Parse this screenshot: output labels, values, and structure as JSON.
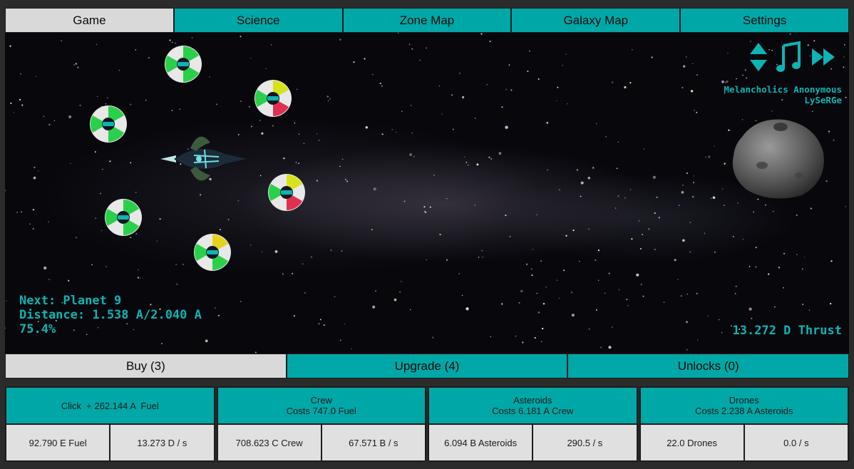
{
  "tabs": [
    {
      "label": "Game",
      "active": true
    },
    {
      "label": "Science",
      "active": false
    },
    {
      "label": "Zone Map",
      "active": false
    },
    {
      "label": "Galaxy Map",
      "active": false
    },
    {
      "label": "Settings",
      "active": false
    }
  ],
  "hud": {
    "next": "Next: Planet 9",
    "distance": "Distance: 1.538 A/2.040 A",
    "progress": "75.4%",
    "thrust": "13.272 D Thrust",
    "music_title": "Melancholics Anonymous",
    "music_artist": "LySeRGe"
  },
  "controls": {
    "icons": [
      "up-down-icon",
      "music-note-icon",
      "fast-forward-icon"
    ],
    "accent": "#0fb3b3"
  },
  "bottom_tabs": [
    {
      "label": "Buy (3)",
      "active": true
    },
    {
      "label": "Upgrade (4)",
      "active": false
    },
    {
      "label": "Unlocks (0)",
      "active": false
    }
  ],
  "panels": {
    "fuel": {
      "head": "Click  + 262.144 A  Fuel",
      "amount": "92.790 E Fuel",
      "rate": "13.273 D / s"
    },
    "crew": {
      "head": "Crew",
      "cost": "Costs 747.0 Fuel",
      "amount": "708.623 C Crew",
      "rate": "67.571 B / s"
    },
    "asteroids": {
      "head": "Asteroids",
      "cost": "Costs 6.181 A Crew",
      "amount": "6.094 B Asteroids",
      "rate": "290.5 / s"
    },
    "drones": {
      "head": "Drones",
      "cost": "Costs 2.238 A Asteroids",
      "amount": "22.0 Drones",
      "rate": "0.0 / s"
    }
  },
  "colors": {
    "teal": "#00a7a7",
    "tab_active": "#d9d9d9",
    "hud_text": "#0fb3b3"
  }
}
